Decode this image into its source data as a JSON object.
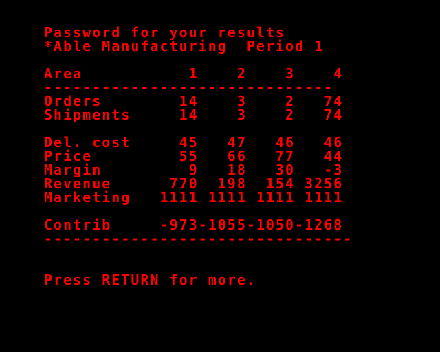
{
  "header": {
    "title": "Password for your results",
    "company_period": "*Able Manufacturing  Period 1"
  },
  "table": {
    "column_header": "Area           1    2    3    4",
    "rule_top": "------------------------------",
    "rows": [
      {
        "label": "Orders",
        "text": "Orders        14    3    2   74"
      },
      {
        "label": "Shipments",
        "text": "Shipments     14    3    2   74"
      },
      {
        "label": "Del. cost",
        "text": "Del. cost     45   47   46   46"
      },
      {
        "label": "Price",
        "text": "Price         55   66   77   44"
      },
      {
        "label": "Margin",
        "text": "Margin         9   18   30   -3"
      },
      {
        "label": "Revenue",
        "text": "Revenue      770  198  154 3256"
      },
      {
        "label": "Marketing",
        "text": "Marketing   1111 1111 1111 1111"
      }
    ],
    "contrib": "Contrib     -973-1055-1050-1268",
    "rule_bottom": "--------------------------------"
  },
  "prompt": "Press RETURN for more.",
  "colors": {
    "background": "#000000",
    "text": "#ff0000"
  }
}
